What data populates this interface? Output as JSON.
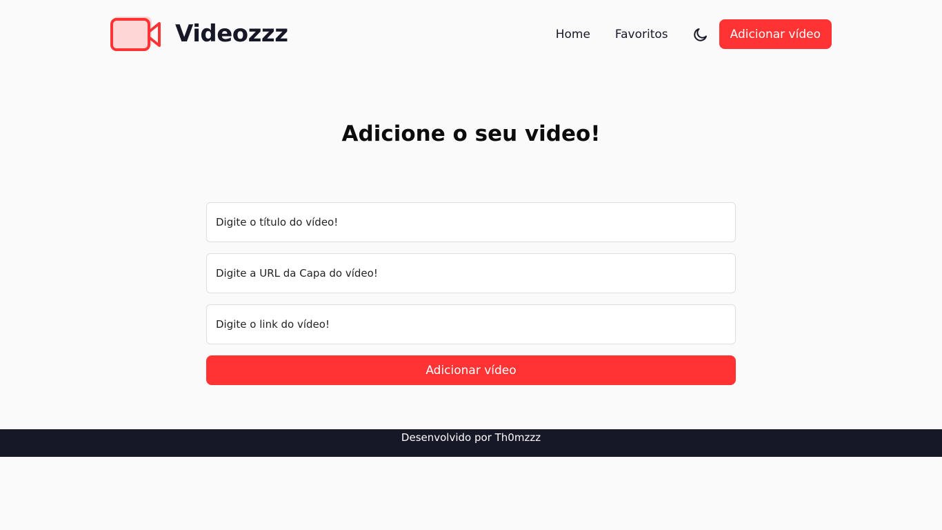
{
  "colors": {
    "accent": "#ff3333",
    "dark": "#161827",
    "background": "#fafafa"
  },
  "header": {
    "logo_icon": "video-camera-icon",
    "brand": "Videozzz",
    "nav": {
      "home": "Home",
      "favorites": "Favoritos"
    },
    "theme_icon": "moon-icon",
    "add_button": "Adicionar vídeo"
  },
  "main": {
    "title": "Adicione o seu video!",
    "form": {
      "title_placeholder": "Digite o título do vídeo!",
      "cover_placeholder": "Digite a URL da Capa do vídeo!",
      "link_placeholder": "Digite o link do vídeo!",
      "submit": "Adicionar vídeo"
    }
  },
  "footer": {
    "text": "Desenvolvido por Th0mzzz"
  }
}
